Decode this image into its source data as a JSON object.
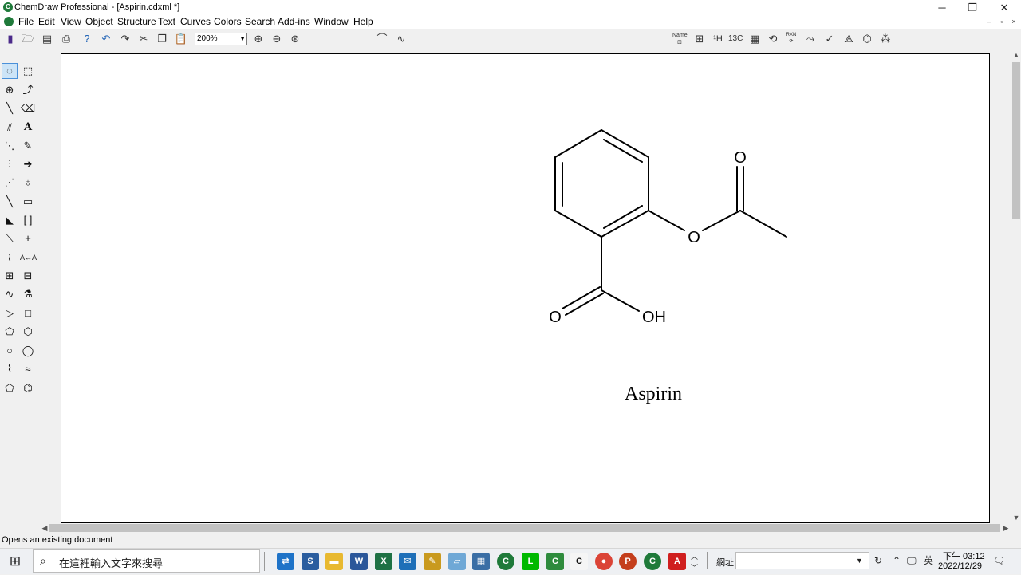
{
  "window": {
    "title": "ChemDraw Professional - [Aspirin.cdxml *]",
    "controls": {
      "minimize": "─",
      "maximize": "❐",
      "close": "✕"
    }
  },
  "menu": {
    "items": [
      "File",
      "Edit",
      "View",
      "Object",
      "Structure",
      "Text",
      "Curves",
      "Colors",
      "Search",
      "Add-ins",
      "Window",
      "Help"
    ],
    "mdi_controls": {
      "minimize": "–",
      "restore": "▫",
      "close": "×"
    }
  },
  "toolbar": {
    "zoom_value": "200%",
    "right_tools": {
      "name_struct": "Name",
      "nmr_h": "¹H",
      "nmr_c": "13C",
      "rxn": "RXN"
    }
  },
  "molecule": {
    "name": "Aspirin",
    "atom_labels": {
      "carbonyl_o_ester": "O",
      "ester_o": "O",
      "acid_o": "O",
      "acid_oh": "OH"
    }
  },
  "status": {
    "message": "Opens an existing document"
  },
  "taskbar": {
    "search_placeholder": "在這裡輸入文字來搜尋",
    "address_label": "網址",
    "clock_time": "下午 03:12",
    "clock_date": "2022/12/29"
  }
}
